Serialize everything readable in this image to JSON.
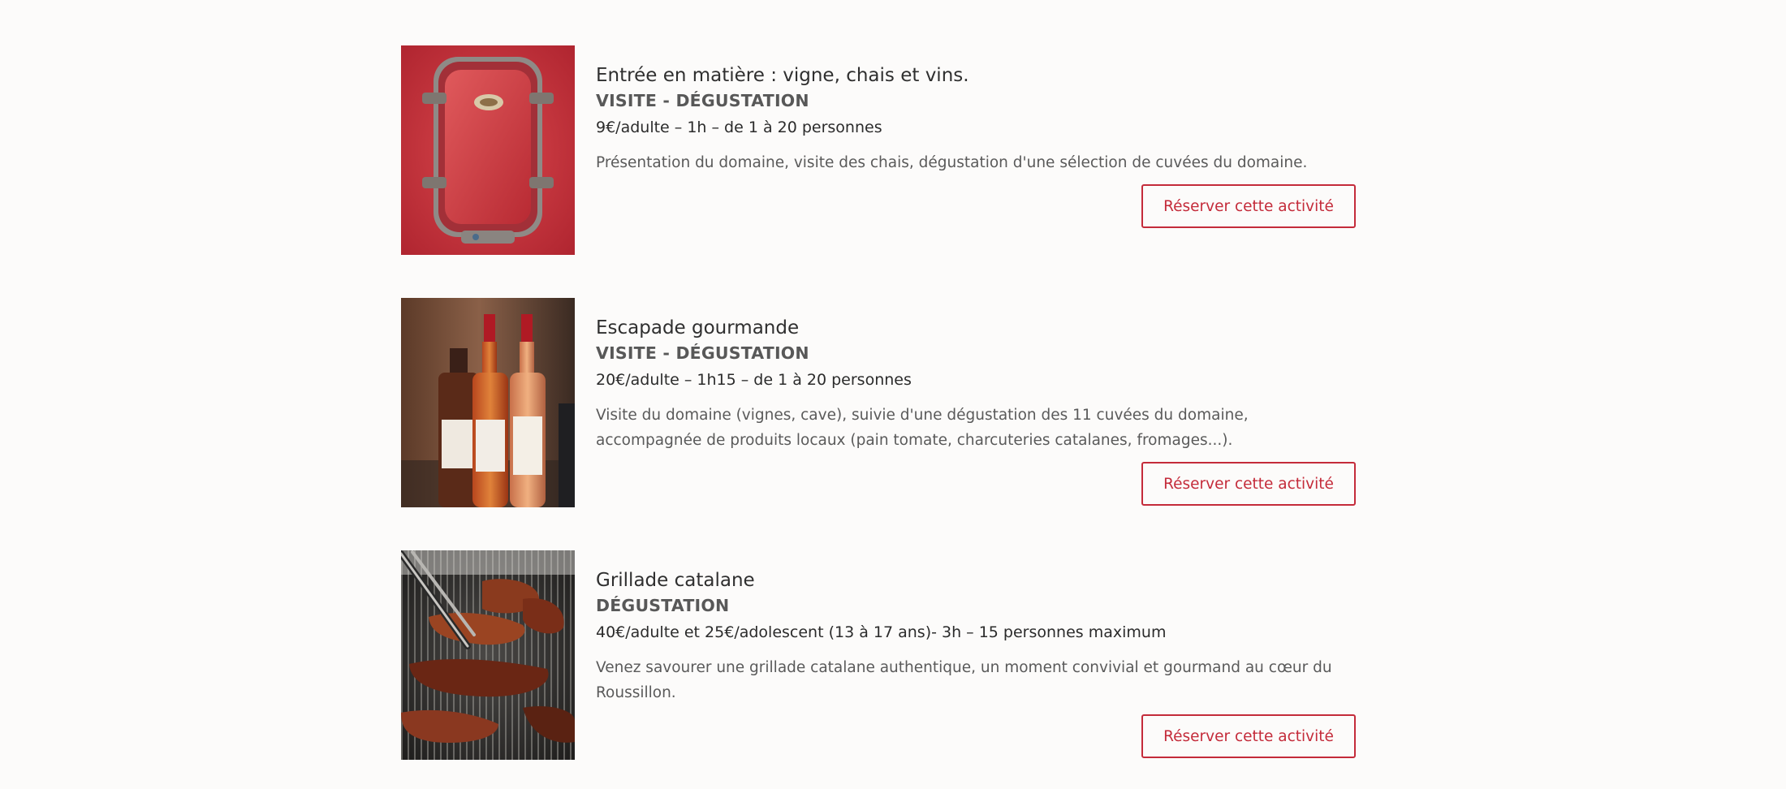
{
  "activities": [
    {
      "image_icon": "porthole-photo",
      "title": "Entrée en matière : vigne, chais et vins.",
      "category": "VISITE - DÉGUSTATION",
      "meta": "9€/adulte – 1h – de 1 à 20 personnes",
      "description": "Présentation du domaine, visite des chais, dégustation d'une sélection de cuvées du domaine.",
      "button_label": "Réserver cette activité"
    },
    {
      "image_icon": "wine-bottles-photo",
      "title": "Escapade gourmande",
      "category": "VISITE - DÉGUSTATION",
      "meta": "20€/adulte – 1h15 – de 1 à 20 personnes",
      "description": "Visite du domaine (vignes, cave), suivie d'une dégustation des 11 cuvées du domaine, accompagnée de produits locaux (pain tomate, charcuteries catalanes, fromages...).",
      "button_label": "Réserver cette activité"
    },
    {
      "image_icon": "grill-photo",
      "title": "Grillade catalane",
      "category": "DÉGUSTATION",
      "meta": "40€/adulte et 25€/adolescent (13 à 17 ans)- 3h – 15 personnes maximum",
      "description": "Venez savourer une grillade catalane authentique, un moment convivial et gourmand au cœur du Roussillon.",
      "button_label": "Réserver cette activité"
    }
  ],
  "colors": {
    "accent": "#c42b3a",
    "background": "#fcfbfa"
  }
}
